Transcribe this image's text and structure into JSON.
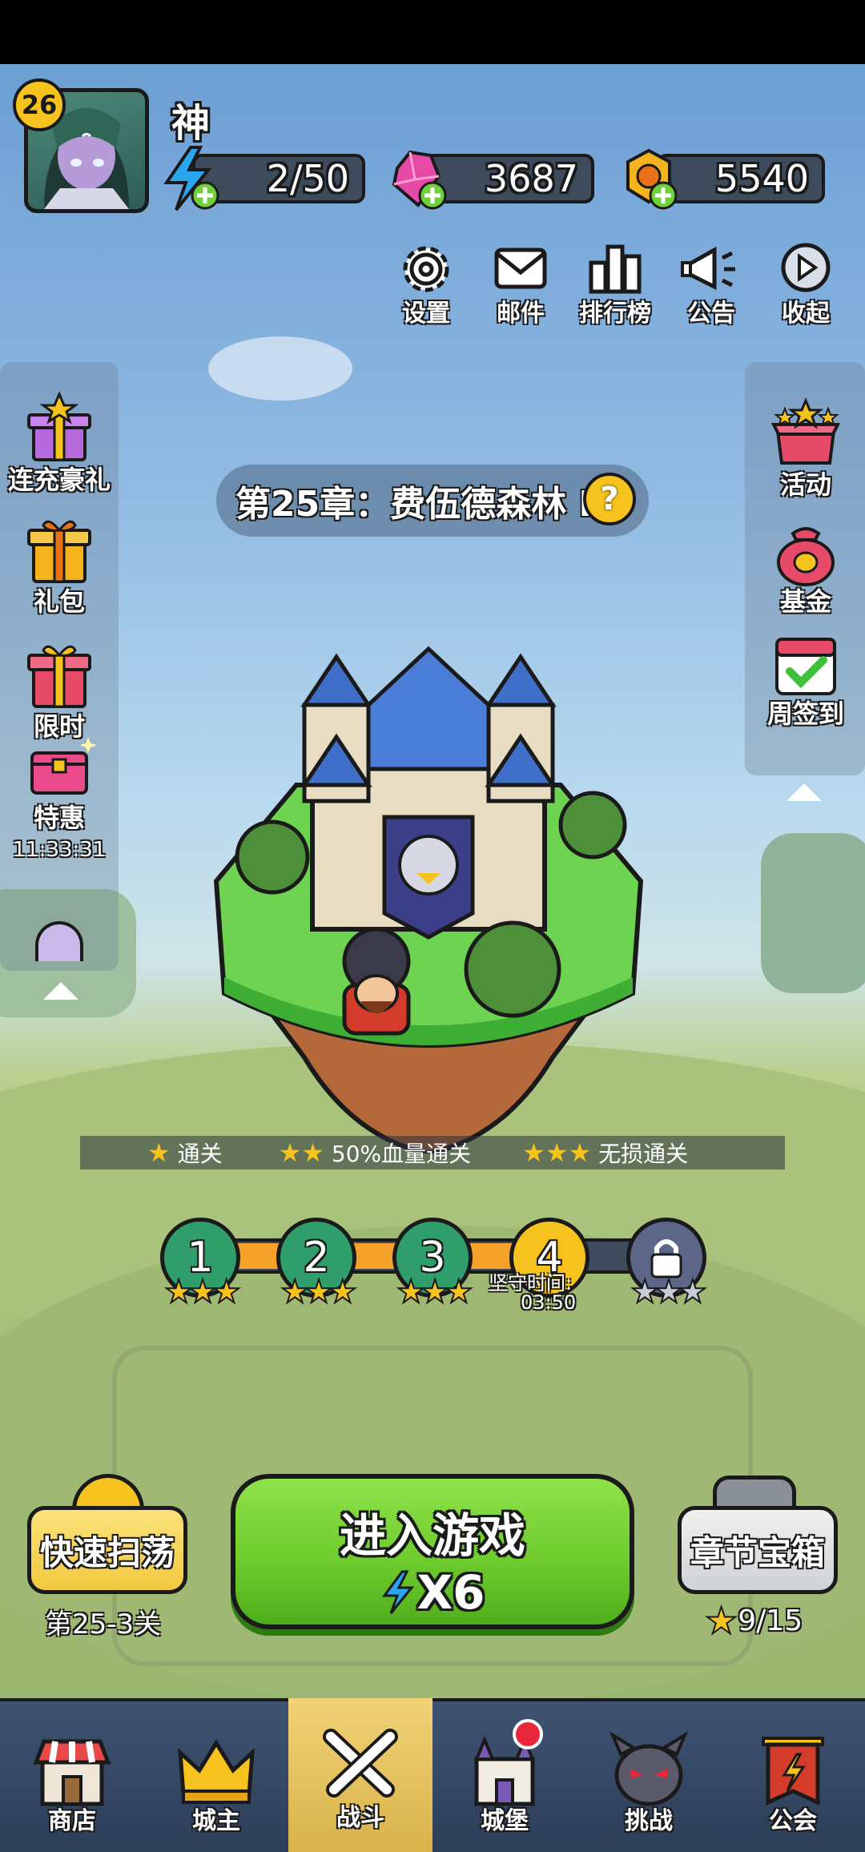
{
  "player": {
    "level": "26",
    "name": "神"
  },
  "resources": {
    "energy": {
      "value": "2/50",
      "icon": "lightning-icon",
      "color": "#2aa5f0"
    },
    "gems": {
      "value": "3687",
      "icon": "gem-icon",
      "color": "#e64aa6"
    },
    "gold": {
      "value": "5540",
      "icon": "coin-icon",
      "color": "#f5b41e"
    }
  },
  "top_buttons": [
    {
      "label": "设置",
      "icon": "gear-icon"
    },
    {
      "label": "邮件",
      "icon": "mail-icon"
    },
    {
      "label": "排行榜",
      "icon": "leaderboard-icon"
    },
    {
      "label": "公告",
      "icon": "megaphone-icon"
    },
    {
      "label": "收起",
      "icon": "play-icon"
    }
  ],
  "left_menu": [
    {
      "label": "连充豪礼",
      "icon": "gift-icon"
    },
    {
      "label": "礼包",
      "icon": "gift-icon"
    },
    {
      "label": "限时",
      "icon": "gift-icon"
    },
    {
      "label": "特惠",
      "icon": "chest-icon",
      "timer": "11:33:31"
    }
  ],
  "right_menu": [
    {
      "label": "活动",
      "icon": "star-box-icon"
    },
    {
      "label": "基金",
      "icon": "money-bag-icon"
    },
    {
      "label": "周签到",
      "icon": "calendar-check-icon"
    }
  ],
  "chapter": {
    "title": "第25章：费伍德森林 I",
    "help_icon": "question-icon"
  },
  "star_conditions": [
    {
      "stars": "★",
      "label": "通关"
    },
    {
      "stars": "★★",
      "label": "50%血量通关"
    },
    {
      "stars": "★★★",
      "label": "无损通关"
    }
  ],
  "stages": [
    {
      "number": "1",
      "stars": "★★★",
      "status": "cleared"
    },
    {
      "number": "2",
      "stars": "★★★",
      "status": "cleared"
    },
    {
      "number": "3",
      "stars": "★★★",
      "status": "cleared"
    },
    {
      "number": "4",
      "stars": "",
      "status": "current",
      "note_label": "坚守时间:",
      "note_value": "03:50"
    },
    {
      "number": "",
      "stars": "★★★",
      "status": "locked"
    }
  ],
  "actions": {
    "sweep": {
      "label": "快速扫荡",
      "sub": "第25-3关"
    },
    "enter": {
      "label": "进入游戏",
      "cost": "X6"
    },
    "chest": {
      "label": "章节宝箱",
      "progress": "9/15"
    }
  },
  "bottom_nav": [
    {
      "label": "商店",
      "icon": "shop-icon"
    },
    {
      "label": "城主",
      "icon": "crown-icon"
    },
    {
      "label": "战斗",
      "icon": "crossed-swords-icon",
      "active": true
    },
    {
      "label": "城堡",
      "icon": "castle-icon",
      "badge": true
    },
    {
      "label": "挑战",
      "icon": "demon-icon"
    },
    {
      "label": "公会",
      "icon": "guild-banner-icon"
    }
  ]
}
